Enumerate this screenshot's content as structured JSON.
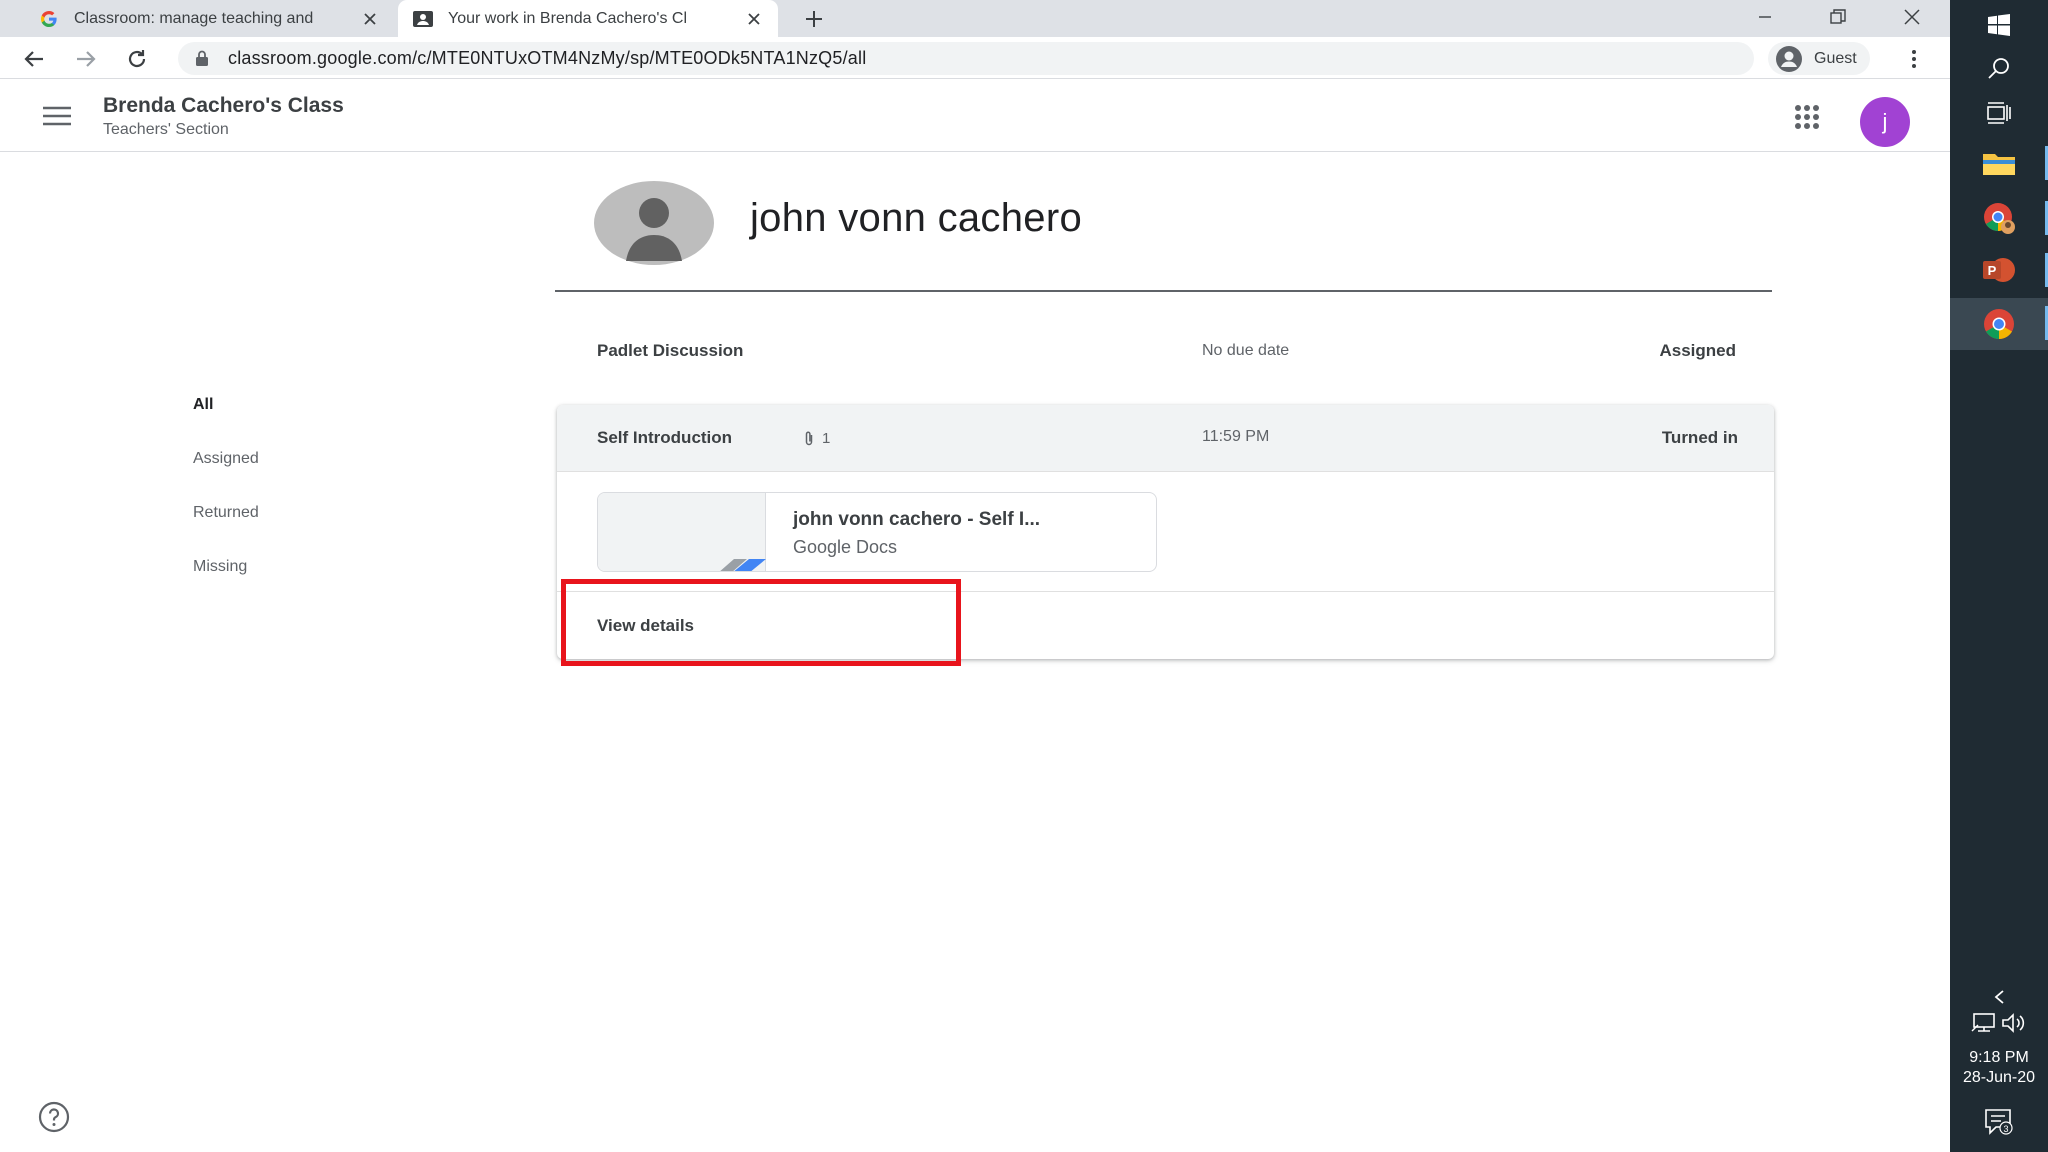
{
  "browser": {
    "tabs": [
      {
        "title": "Classroom: manage teaching and",
        "active": false
      },
      {
        "title": "Your work in Brenda Cachero's Cl",
        "active": true
      }
    ],
    "url": "classroom.google.com/c/MTE0NTUxOTM4NzMy/sp/MTE0ODk5NTA1NzQ5/all",
    "profile_label": "Guest"
  },
  "header": {
    "class_name": "Brenda Cachero's Class",
    "section": "Teachers' Section",
    "avatar_letter": "j",
    "avatar_color": "#a142d3"
  },
  "student": {
    "name": "john vonn cachero"
  },
  "filters": [
    {
      "label": "All",
      "active": true
    },
    {
      "label": "Assigned",
      "active": false
    },
    {
      "label": "Returned",
      "active": false
    },
    {
      "label": "Missing",
      "active": false
    }
  ],
  "assignments": [
    {
      "title": "Padlet Discussion",
      "due": "No due date",
      "status": "Assigned"
    },
    {
      "title": "Self Introduction",
      "attachments_count": "1",
      "due": "11:59 PM",
      "status": "Turned in",
      "attachment": {
        "title": "john vonn cachero - Self I...",
        "type": "Google Docs"
      },
      "view_details_label": "View details"
    }
  ],
  "annotation": {
    "highlight_color": "#e8141c"
  },
  "taskbar": {
    "time": "9:18 PM",
    "date": "28-Jun-20",
    "notifications": "3"
  }
}
